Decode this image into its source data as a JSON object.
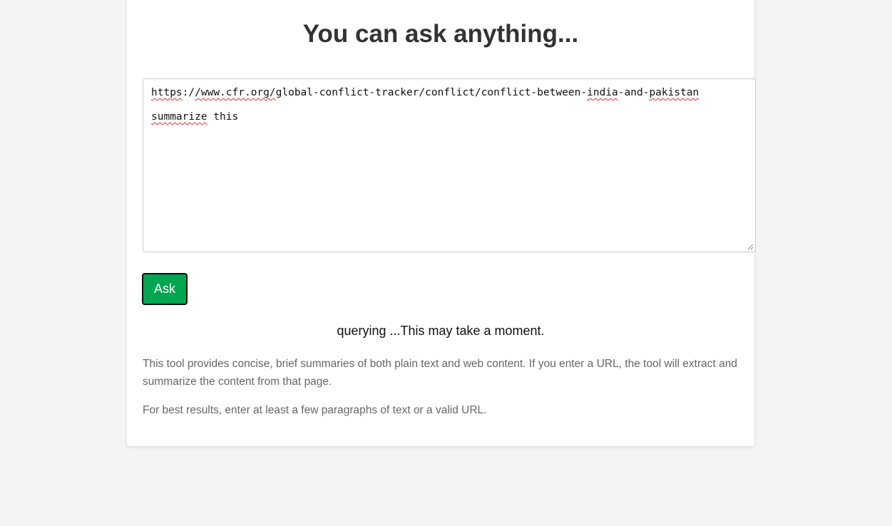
{
  "main": {
    "title": "You can ask anything...",
    "prompt": {
      "line1": {
        "w1": "https",
        "t1": ":/",
        "w2": "/www.cfr.org/",
        "t2": "global-conflict-tracker/conflict/conflict-between-",
        "w3": "india",
        "t3": "-and-",
        "w4": "pakistan"
      },
      "line2": {
        "w1": "summarize",
        "t1": " this"
      }
    },
    "ask_label": "Ask",
    "status": "querying ...This may take a moment.",
    "description": "This tool provides concise, brief summaries of both plain text and web content. If you enter a URL, the tool will extract and summarize the content from that page.",
    "tip": "For best results, enter at least a few paragraphs of text or a valid URL."
  },
  "colors": {
    "button": "#00a650",
    "background": "#f4f4f4",
    "spellcheck": "#e03030"
  }
}
